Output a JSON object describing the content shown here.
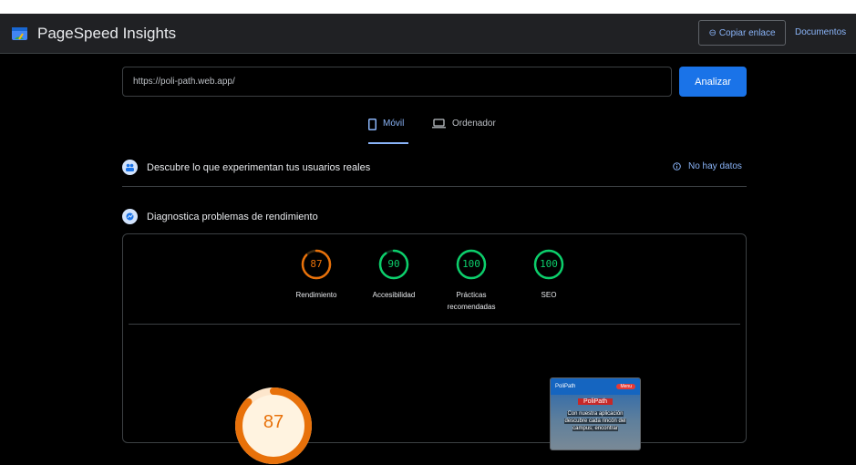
{
  "header": {
    "app_title": "PageSpeed Insights",
    "copy_link": "Copiar enlace",
    "docs": "Documentos"
  },
  "search": {
    "url": "https://poli-path.web.app/",
    "analyze": "Analizar"
  },
  "tabs": [
    {
      "label": "Móvil",
      "icon": "smartphone-icon",
      "active": true
    },
    {
      "label": "Ordenador",
      "icon": "laptop-icon",
      "active": false
    }
  ],
  "sections": {
    "field": {
      "title": "Descubre lo que experimentan tus usuarios reales",
      "status": "No hay datos"
    },
    "lab": {
      "title": "Diagnostica problemas de rendimiento"
    }
  },
  "scores": [
    {
      "label": "Rendimiento",
      "value": "87",
      "color": "#e8710a"
    },
    {
      "label": "Accesibilidad",
      "value": "90",
      "color": "#0cce6b"
    },
    {
      "label": "Prácticas recomendadas",
      "value": "100",
      "color": "#0cce6b"
    },
    {
      "label": "SEO",
      "value": "100",
      "color": "#0cce6b"
    }
  ],
  "performance": {
    "value": "87"
  },
  "screenshot": {
    "brand": "PoliPath",
    "menu_badge": "Menu",
    "hero_title": "PoliPath",
    "hero_text": "Con nuestra aplicación descubre cada rincón del campus; encontrar"
  },
  "colors": {
    "accent": "#1a73e8",
    "link": "#8ab4f8",
    "average": "#e8710a",
    "pass": "#0cce6b"
  }
}
